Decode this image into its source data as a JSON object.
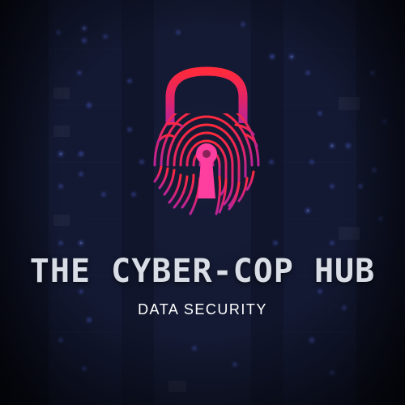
{
  "brand": {
    "title": "THE CYBER-COP HUB",
    "subtitle": "DATA SECURITY"
  },
  "logo": {
    "icon": "fingerprint-padlock-icon",
    "gradient_top": "#ff2a3c",
    "gradient_bottom": "#b8249a",
    "keyhole_color": "#ff3fa0"
  },
  "background": {
    "theme": "server-rack-lights",
    "base_color": "#0c1022",
    "light_color": "#4a63ff"
  }
}
